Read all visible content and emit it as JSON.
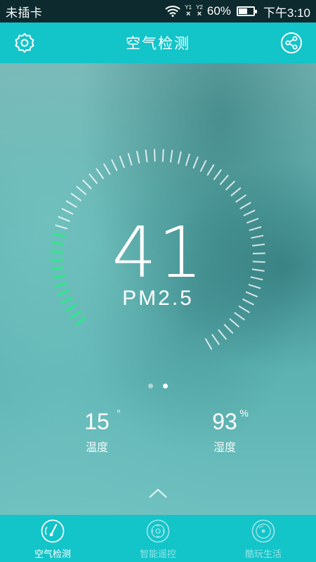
{
  "status_bar": {
    "carrier": "未插卡",
    "sim1": "1",
    "sim2": "2",
    "battery_percent_text": "60%",
    "battery_level": 0.6,
    "time": "下午3:10"
  },
  "header": {
    "title": "空气检测",
    "left_icon": "gear-icon",
    "right_icon": "share-icon"
  },
  "gauge": {
    "value": "41",
    "label": "PM2.5",
    "active_fraction": 0.2,
    "active_color": "#2ee88a"
  },
  "pager": {
    "count": 2,
    "active_index": 1
  },
  "stats": {
    "temperature": {
      "value": "15",
      "unit": "°",
      "label": "温度"
    },
    "humidity": {
      "value": "93",
      "unit": "%",
      "label": "湿度"
    }
  },
  "bottom_nav": {
    "items": [
      {
        "label": "空气检测",
        "icon": "gauge-icon",
        "active": true
      },
      {
        "label": "智能遥控",
        "icon": "remote-icon",
        "active": false
      },
      {
        "label": "酷玩生活",
        "icon": "disc-icon",
        "active": false
      }
    ]
  },
  "colors": {
    "accent": "#13c4c9",
    "status_bar": "#0d2a2f"
  }
}
